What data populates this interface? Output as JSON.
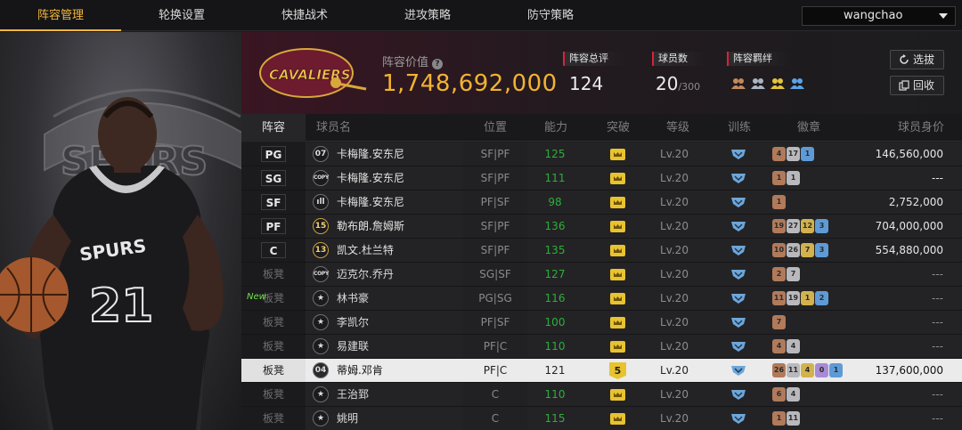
{
  "nav": {
    "tabs": [
      {
        "label": "阵容管理",
        "active": true
      },
      {
        "label": "轮换设置"
      },
      {
        "label": "快捷战术"
      },
      {
        "label": "进攻策略"
      },
      {
        "label": "防守策略"
      }
    ],
    "user": "wangchao"
  },
  "left_panel": {
    "jersey_number": "21"
  },
  "team": {
    "logo_text": "CAVALIERS",
    "lineup_value_label": "阵容价值",
    "lineup_value": "1,748,692,000",
    "stats": [
      {
        "label": "阵容总评",
        "value": "124"
      },
      {
        "label": "球员数",
        "value": "20",
        "max": "/300"
      },
      {
        "label": "阵容羁绊"
      }
    ],
    "buttons": {
      "select": "选拔",
      "recycle": "回收"
    }
  },
  "table": {
    "headers": [
      "阵容",
      "球员名",
      "位置",
      "能力",
      "突破",
      "等级",
      "训练",
      "徽章",
      "球员身价"
    ],
    "rows": [
      {
        "pos": "PG",
        "starter": true,
        "badge": "07",
        "badge_type": "num",
        "name": "卡梅隆.安东尼",
        "position": "SF|PF",
        "ability": "125",
        "breakthrough": "crown",
        "level": "Lv.20",
        "medals": [
          {
            "v": "4",
            "c": "bronze"
          },
          {
            "v": "17",
            "c": "silver"
          },
          {
            "v": "1",
            "c": "blue"
          }
        ],
        "value": "146,560,000"
      },
      {
        "pos": "SG",
        "starter": true,
        "badge": "COPY",
        "badge_type": "copy",
        "name": "卡梅隆.安东尼",
        "position": "SF|PF",
        "ability": "111",
        "breakthrough": "crown",
        "level": "Lv.20",
        "medals": [
          {
            "v": "1",
            "c": "bronze"
          },
          {
            "v": "1",
            "c": "silver"
          }
        ],
        "value": "---"
      },
      {
        "pos": "SF",
        "starter": true,
        "badge": "ıll",
        "badge_type": "num",
        "name": "卡梅隆.安东尼",
        "position": "PF|SF",
        "ability": "98",
        "breakthrough": "crown",
        "level": "Lv.20",
        "medals": [
          {
            "v": "1",
            "c": "bronze"
          }
        ],
        "value": "2,752,000"
      },
      {
        "pos": "PF",
        "starter": true,
        "badge": "15",
        "badge_type": "gold",
        "name": "勒布朗.詹姆斯",
        "position": "SF|PF",
        "ability": "136",
        "breakthrough": "crown",
        "level": "Lv.20",
        "medals": [
          {
            "v": "19",
            "c": "bronze"
          },
          {
            "v": "27",
            "c": "silver"
          },
          {
            "v": "12",
            "c": "gold"
          },
          {
            "v": "3",
            "c": "blue"
          }
        ],
        "value": "704,000,000"
      },
      {
        "pos": "C",
        "starter": true,
        "badge": "13",
        "badge_type": "gold",
        "name": "凯文.杜兰特",
        "position": "SF|PF",
        "ability": "135",
        "breakthrough": "crown",
        "level": "Lv.20",
        "medals": [
          {
            "v": "10",
            "c": "bronze"
          },
          {
            "v": "26",
            "c": "silver"
          },
          {
            "v": "7",
            "c": "gold"
          },
          {
            "v": "3",
            "c": "blue"
          }
        ],
        "value": "554,880,000"
      },
      {
        "pos": "板凳",
        "badge": "COPY",
        "badge_type": "copy",
        "name": "迈克尔.乔丹",
        "position": "SG|SF",
        "ability": "127",
        "breakthrough": "crown",
        "level": "Lv.20",
        "medals": [
          {
            "v": "2",
            "c": "bronze"
          },
          {
            "v": "7",
            "c": "silver"
          }
        ],
        "value": "---"
      },
      {
        "pos": "板凳",
        "new": "New",
        "badge": "★",
        "badge_type": "star",
        "name": "林书豪",
        "position": "PG|SG",
        "ability": "116",
        "breakthrough": "crown",
        "level": "Lv.20",
        "medals": [
          {
            "v": "11",
            "c": "bronze"
          },
          {
            "v": "19",
            "c": "silver"
          },
          {
            "v": "1",
            "c": "gold"
          },
          {
            "v": "2",
            "c": "blue"
          }
        ],
        "value": "---"
      },
      {
        "pos": "板凳",
        "badge": "★",
        "badge_type": "star",
        "name": "李凯尔",
        "position": "PF|SF",
        "ability": "100",
        "breakthrough": "crown",
        "level": "Lv.20",
        "medals": [
          {
            "v": "7",
            "c": "bronze"
          }
        ],
        "value": "---"
      },
      {
        "pos": "板凳",
        "badge": "★",
        "badge_type": "star",
        "name": "易建联",
        "position": "PF|C",
        "ability": "110",
        "breakthrough": "crown",
        "level": "Lv.20",
        "medals": [
          {
            "v": "4",
            "c": "bronze"
          },
          {
            "v": "4",
            "c": "silver"
          }
        ],
        "value": "---"
      },
      {
        "pos": "板凳",
        "selected": true,
        "badge": "04",
        "badge_type": "num",
        "name": "蒂姆.邓肯",
        "position": "PF|C",
        "ability": "121",
        "breakthrough": "5",
        "level": "Lv.20",
        "medals": [
          {
            "v": "26",
            "c": "bronze"
          },
          {
            "v": "11",
            "c": "silver"
          },
          {
            "v": "4",
            "c": "gold"
          },
          {
            "v": "0",
            "c": "purple"
          },
          {
            "v": "1",
            "c": "blue"
          }
        ],
        "value": "137,600,000"
      },
      {
        "pos": "板凳",
        "badge": "★",
        "badge_type": "star",
        "name": "王治郅",
        "position": "C",
        "ability": "110",
        "breakthrough": "crown",
        "level": "Lv.20",
        "medals": [
          {
            "v": "6",
            "c": "bronze"
          },
          {
            "v": "4",
            "c": "silver"
          }
        ],
        "value": "---"
      },
      {
        "pos": "板凳",
        "badge": "★",
        "badge_type": "star",
        "name": "姚明",
        "position": "C",
        "ability": "115",
        "breakthrough": "crown",
        "level": "Lv.20",
        "medals": [
          {
            "v": "1",
            "c": "bronze"
          },
          {
            "v": "11",
            "c": "silver"
          }
        ],
        "value": "---"
      }
    ]
  },
  "colors": {
    "accent": "#f3b63d",
    "ability_green": "#2fae3b",
    "stat_bar_red": "#d6233a",
    "value_gold": "#f2b331"
  }
}
